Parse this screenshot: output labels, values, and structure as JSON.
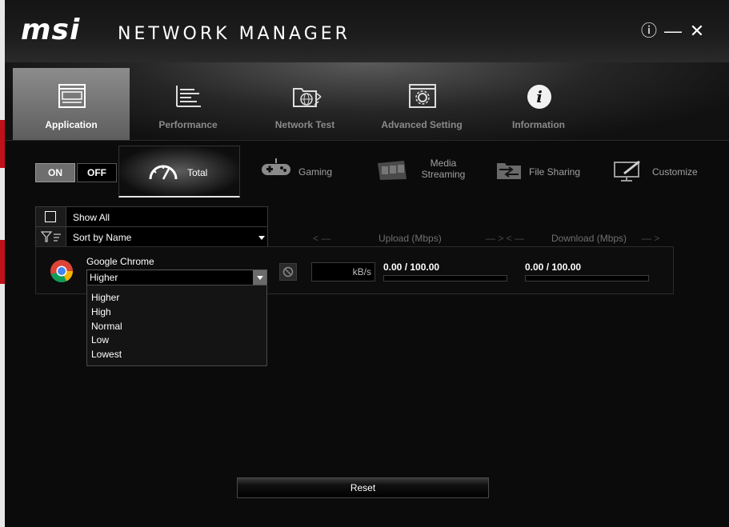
{
  "app": {
    "brand": "msi",
    "product": "NETWORK MANAGER"
  },
  "window_controls": {
    "info": "ⓘ",
    "minimize": "—",
    "close": "✕"
  },
  "tabs": [
    {
      "label": "Application",
      "icon": "application-window-icon",
      "active": true
    },
    {
      "label": "Performance",
      "icon": "performance-list-icon",
      "active": false
    },
    {
      "label": "Network Test",
      "icon": "network-test-globe-icon",
      "active": false
    },
    {
      "label": "Advanced Setting",
      "icon": "advanced-gear-window-icon",
      "active": false
    },
    {
      "label": "Information",
      "icon": "info-circle-icon",
      "active": false
    }
  ],
  "toggle": {
    "on": "ON",
    "off": "OFF",
    "state": "ON"
  },
  "modes": [
    {
      "label": "Total",
      "icon": "speedometer-icon",
      "active": true
    },
    {
      "label": "Gaming",
      "icon": "gamepad-icon",
      "active": false
    },
    {
      "label": "Media\nStreaming",
      "icon": "film-strip-icon",
      "active": false
    },
    {
      "label": "File Sharing",
      "icon": "file-sharing-icon",
      "active": false
    },
    {
      "label": "Customize",
      "icon": "customize-monitor-icon",
      "active": false
    }
  ],
  "filters": {
    "show_all": "Show All",
    "sort_by": "Sort by Name"
  },
  "columns": {
    "upload": "Upload (Mbps)",
    "download": "Download (Mbps)"
  },
  "apps": [
    {
      "name": "Google Chrome",
      "priority": "Higher",
      "unit": "kB/s",
      "upload": "0.00 / 100.00",
      "download": "0.00 / 100.00"
    }
  ],
  "priority_options": [
    "Higher",
    "High",
    "Normal",
    "Low",
    "Lowest"
  ],
  "reset_label": "Reset",
  "colors": {
    "background": "#0b0b0b",
    "active_tab": "#7a7a7a",
    "text": "#ffffff",
    "muted": "#8a8a8a"
  }
}
